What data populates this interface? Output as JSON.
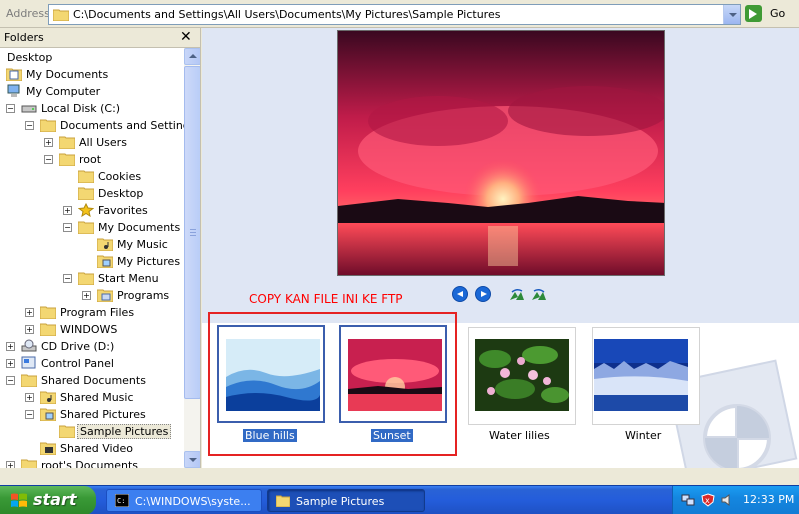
{
  "address": {
    "label": "Address",
    "path": "C:\\Documents and Settings\\All Users\\Documents\\My Pictures\\Sample Pictures",
    "go_label": "Go"
  },
  "folders_pane": {
    "title": "Folders",
    "close": "✕",
    "items": [
      {
        "label": "Desktop",
        "icon": "desktop-icon"
      },
      {
        "label": "My Documents",
        "icon": "my-documents-icon"
      },
      {
        "label": "My Computer",
        "icon": "my-computer-icon"
      },
      {
        "label": "Local Disk (C:)",
        "icon": "hard-drive-icon",
        "expander": "−"
      },
      {
        "label": "Documents and Settings",
        "icon": "folder-open-icon",
        "expander": "−"
      },
      {
        "label": "All Users",
        "icon": "folder-icon",
        "expander": "+"
      },
      {
        "label": "root",
        "icon": "folder-open-icon",
        "expander": "−"
      },
      {
        "label": "Cookies",
        "icon": "folder-icon"
      },
      {
        "label": "Desktop",
        "icon": "folder-icon"
      },
      {
        "label": "Favorites",
        "icon": "favorites-star-icon",
        "expander": "+"
      },
      {
        "label": "My Documents",
        "icon": "folder-open-icon",
        "expander": "−"
      },
      {
        "label": "My Music",
        "icon": "music-folder-icon"
      },
      {
        "label": "My Pictures",
        "icon": "pictures-folder-icon"
      },
      {
        "label": "Start Menu",
        "icon": "folder-open-icon",
        "expander": "−"
      },
      {
        "label": "Programs",
        "icon": "programs-folder-icon",
        "expander": "+"
      },
      {
        "label": "Program Files",
        "icon": "folder-icon",
        "expander": "+"
      },
      {
        "label": "WINDOWS",
        "icon": "folder-icon",
        "expander": "+"
      },
      {
        "label": "CD Drive (D:)",
        "icon": "cd-drive-icon",
        "expander": "+"
      },
      {
        "label": "Control Panel",
        "icon": "control-panel-icon",
        "expander": "+"
      },
      {
        "label": "Shared Documents",
        "icon": "folder-open-icon",
        "expander": "−"
      },
      {
        "label": "Shared Music",
        "icon": "music-folder-icon",
        "expander": "+"
      },
      {
        "label": "Shared Pictures",
        "icon": "pictures-folder-icon",
        "expander": "−"
      },
      {
        "label": "Sample Pictures",
        "icon": "folder-open-icon",
        "selected": true
      },
      {
        "label": "Shared Video",
        "icon": "video-folder-icon"
      },
      {
        "label": "root's Documents",
        "icon": "folder-icon",
        "expander": "+"
      }
    ]
  },
  "annotation": "COPY KAN FILE INI KE FTP",
  "thumbnails": [
    {
      "caption": "Blue hills",
      "selected": true
    },
    {
      "caption": "Sunset",
      "selected": true
    },
    {
      "caption": "Water lilies",
      "selected": false
    },
    {
      "caption": "Winter",
      "selected": false
    }
  ],
  "taskbar": {
    "start_label": "start",
    "tasks": [
      {
        "label": "C:\\WINDOWS\\syste...",
        "icon": "command-prompt-icon"
      },
      {
        "label": "Sample Pictures",
        "icon": "folder-icon"
      }
    ],
    "clock": "12:33 PM"
  },
  "colors": {
    "annotation": "#ff0000",
    "selection_box": "#e52323",
    "selection_highlight": "#316ac5",
    "taskbar_blue": "#245ddb",
    "start_green": "#3a9a37"
  }
}
